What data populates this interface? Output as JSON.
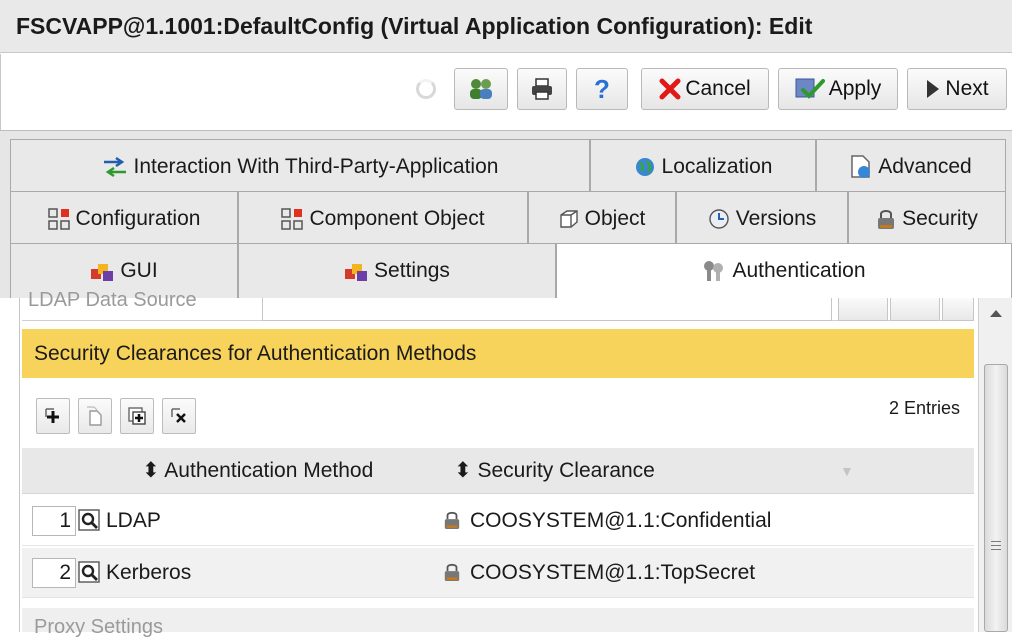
{
  "window": {
    "title": "FSCVAPP@1.1001:DefaultConfig (Virtual Application Configuration): Edit"
  },
  "toolbar": {
    "cancel_label": "Cancel",
    "apply_label": "Apply",
    "next_label": "Next",
    "help_label": "?"
  },
  "tabs": {
    "row1": [
      {
        "label": "Interaction With Third-Party-Application",
        "icon": "interaction-icon"
      },
      {
        "label": "Localization",
        "icon": "globe-icon"
      },
      {
        "label": "Advanced",
        "icon": "advanced-icon"
      }
    ],
    "row2": [
      {
        "label": "Configuration",
        "icon": "configuration-icon"
      },
      {
        "label": "Component Object",
        "icon": "component-icon"
      },
      {
        "label": "Object",
        "icon": "object-cube-icon"
      },
      {
        "label": "Versions",
        "icon": "versions-icon"
      },
      {
        "label": "Security",
        "icon": "lock-icon"
      }
    ],
    "row3": [
      {
        "label": "GUI",
        "icon": "gui-icon"
      },
      {
        "label": "Settings",
        "icon": "settings-icon"
      },
      {
        "label": "Authentication",
        "icon": "keys-icon",
        "active": true
      }
    ]
  },
  "content": {
    "ldap_data_source_label": "LDAP Data Source",
    "section_title": "Security Clearances for Authentication Methods",
    "entries_count": "2 Entries",
    "columns": {
      "method": "Authentication Method",
      "clearance": "Security Clearance"
    },
    "rows": [
      {
        "num": "1",
        "method": "LDAP",
        "clearance": "COOSYSTEM@1.1:Confidential"
      },
      {
        "num": "2",
        "method": "Kerberos",
        "clearance": "COOSYSTEM@1.1:TopSecret"
      }
    ],
    "proxy_label": "Proxy Settings"
  },
  "colors": {
    "section_header": "#f8d35c",
    "cancel_x": "#e01818",
    "help": "#2a6fd6"
  }
}
